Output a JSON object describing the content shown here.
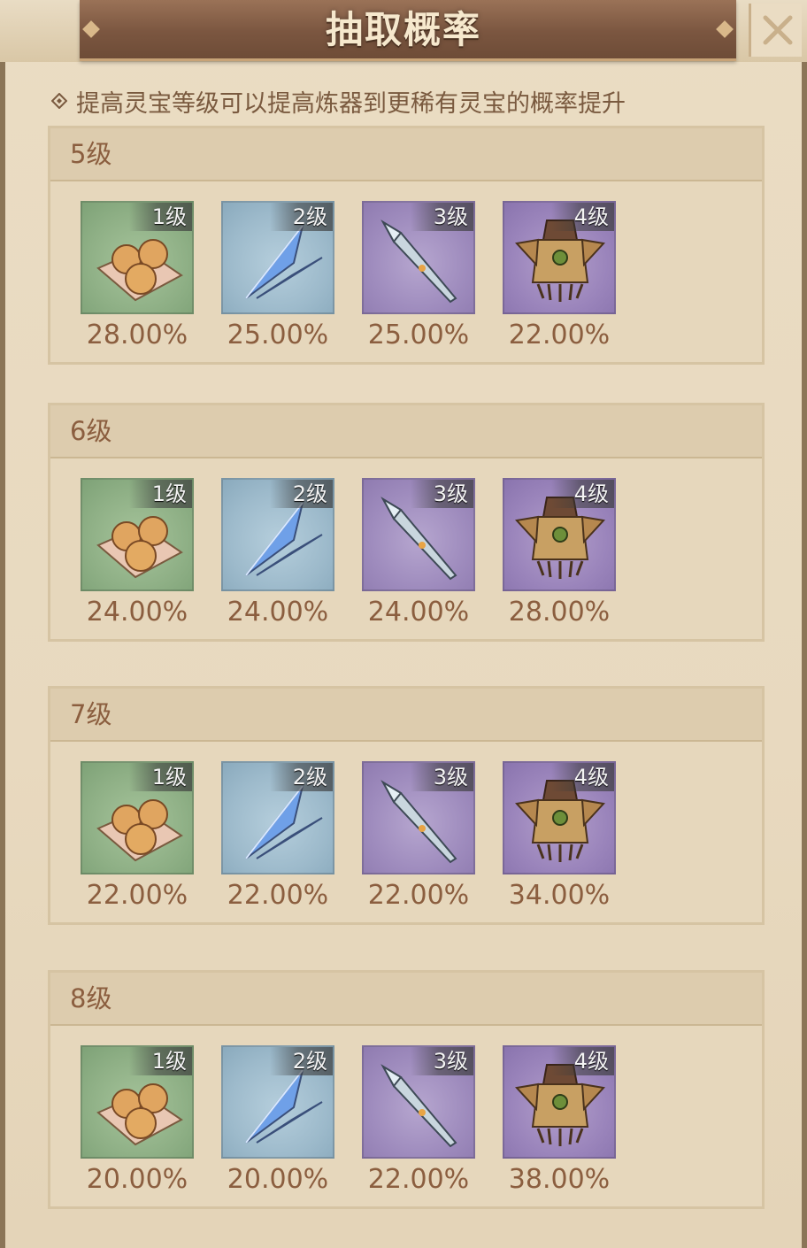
{
  "header": {
    "title": "抽取概率"
  },
  "tip": {
    "text": "提高灵宝等级可以提高炼器到更稀有灵宝的概率提升"
  },
  "sections": [
    {
      "title": "5级",
      "items": [
        {
          "tier": "1级",
          "pct": "28.00%"
        },
        {
          "tier": "2级",
          "pct": "25.00%"
        },
        {
          "tier": "3级",
          "pct": "25.00%"
        },
        {
          "tier": "4级",
          "pct": "22.00%"
        }
      ]
    },
    {
      "title": "6级",
      "items": [
        {
          "tier": "1级",
          "pct": "24.00%"
        },
        {
          "tier": "2级",
          "pct": "24.00%"
        },
        {
          "tier": "3级",
          "pct": "24.00%"
        },
        {
          "tier": "4级",
          "pct": "28.00%"
        }
      ]
    },
    {
      "title": "7级",
      "items": [
        {
          "tier": "1级",
          "pct": "22.00%"
        },
        {
          "tier": "2级",
          "pct": "22.00%"
        },
        {
          "tier": "3级",
          "pct": "22.00%"
        },
        {
          "tier": "4级",
          "pct": "34.00%"
        }
      ]
    },
    {
      "title": "8级",
      "items": [
        {
          "tier": "1级",
          "pct": "20.00%"
        },
        {
          "tier": "2级",
          "pct": "20.00%"
        },
        {
          "tier": "3级",
          "pct": "22.00%"
        },
        {
          "tier": "4级",
          "pct": "38.00%"
        }
      ]
    }
  ],
  "icons": {
    "tier1": "buns-icon",
    "tier2": "blue-feather-icon",
    "tier3": "spear-icon",
    "tier4": "armor-icon"
  },
  "colors": {
    "tier1_bg": "#8fb086",
    "tier2_bg": "#9dbacb",
    "tier3_bg": "#9e8bbd",
    "tier4_bg": "#9a84bb",
    "text_brown": "#8b5e3f"
  }
}
